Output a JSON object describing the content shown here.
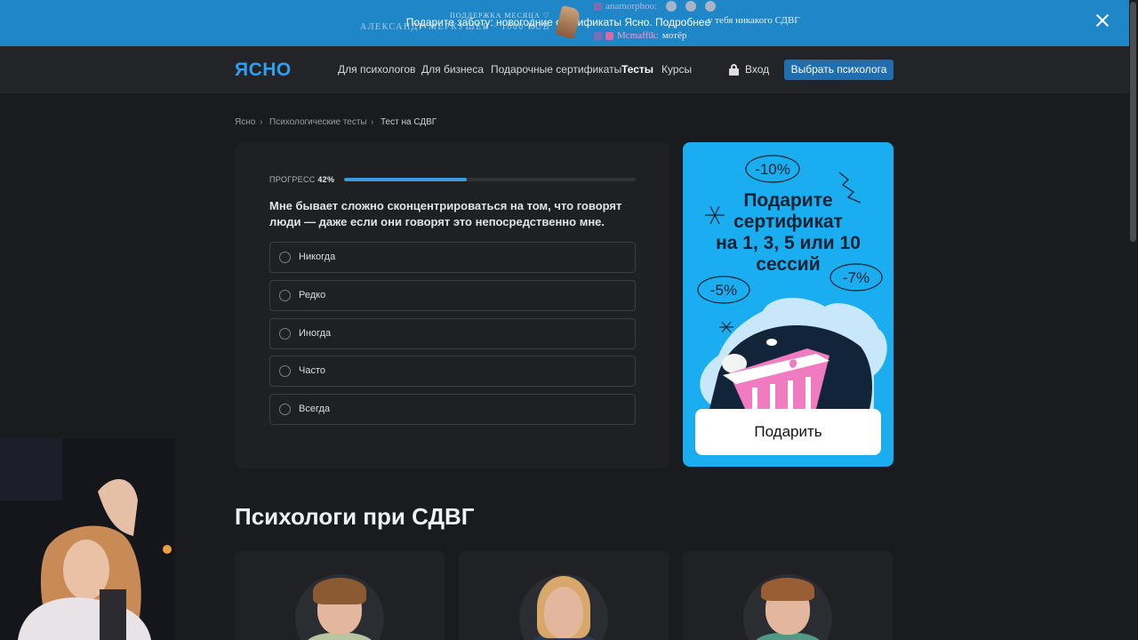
{
  "banner": {
    "text": "Подарите заботу: новогодние сертификаты Ясно. Подробнее",
    "close_icon": "close-icon"
  },
  "overlay": {
    "support_label": "ПОДДЕРЖКА МЕСЯЦА ♡",
    "donor": "АЛЕКСАНДР МЕРКУШЕВ · 1000 RUB",
    "chat": [
      {
        "user": "anamorphoo:",
        "message": ""
      },
      {
        "user": "",
        "message": "у тебя никакого СДВГ"
      },
      {
        "user": "Mcmaffik:",
        "message": "мотёр"
      }
    ]
  },
  "header": {
    "logo": "ЯСНО",
    "nav": [
      "Для психологов",
      "Для бизнеса",
      "Подарочные сертификаты",
      "Тесты",
      "Курсы"
    ],
    "active_nav": "Тесты",
    "login": "Вход",
    "cta": "Выбрать психолога"
  },
  "breadcrumbs": [
    "Ясно",
    "Психологические тесты",
    "Тест на СДВГ"
  ],
  "quiz": {
    "progress_label": "ПРОГРЕСС",
    "progress_value": "42%",
    "progress_fraction": 0.42,
    "question": "Мне бывает сложно сконцентрироваться на том, что говорят люди — даже если они говорят это непосредственно мне.",
    "options": [
      "Никогда",
      "Редко",
      "Иногда",
      "Часто",
      "Всегда"
    ]
  },
  "promo": {
    "title_lines": [
      "Подарите",
      "сертификат",
      "на 1, 3, 5 или 10",
      "сессий"
    ],
    "discounts": [
      "-10%",
      "-5%",
      "-7%"
    ],
    "button": "Подарить"
  },
  "section": {
    "title": "Психологи при СДВГ"
  },
  "colors": {
    "accent": "#1aaef0",
    "banner": "#1f86c8",
    "cta": "#1f6fb0",
    "background": "#191b1e"
  }
}
